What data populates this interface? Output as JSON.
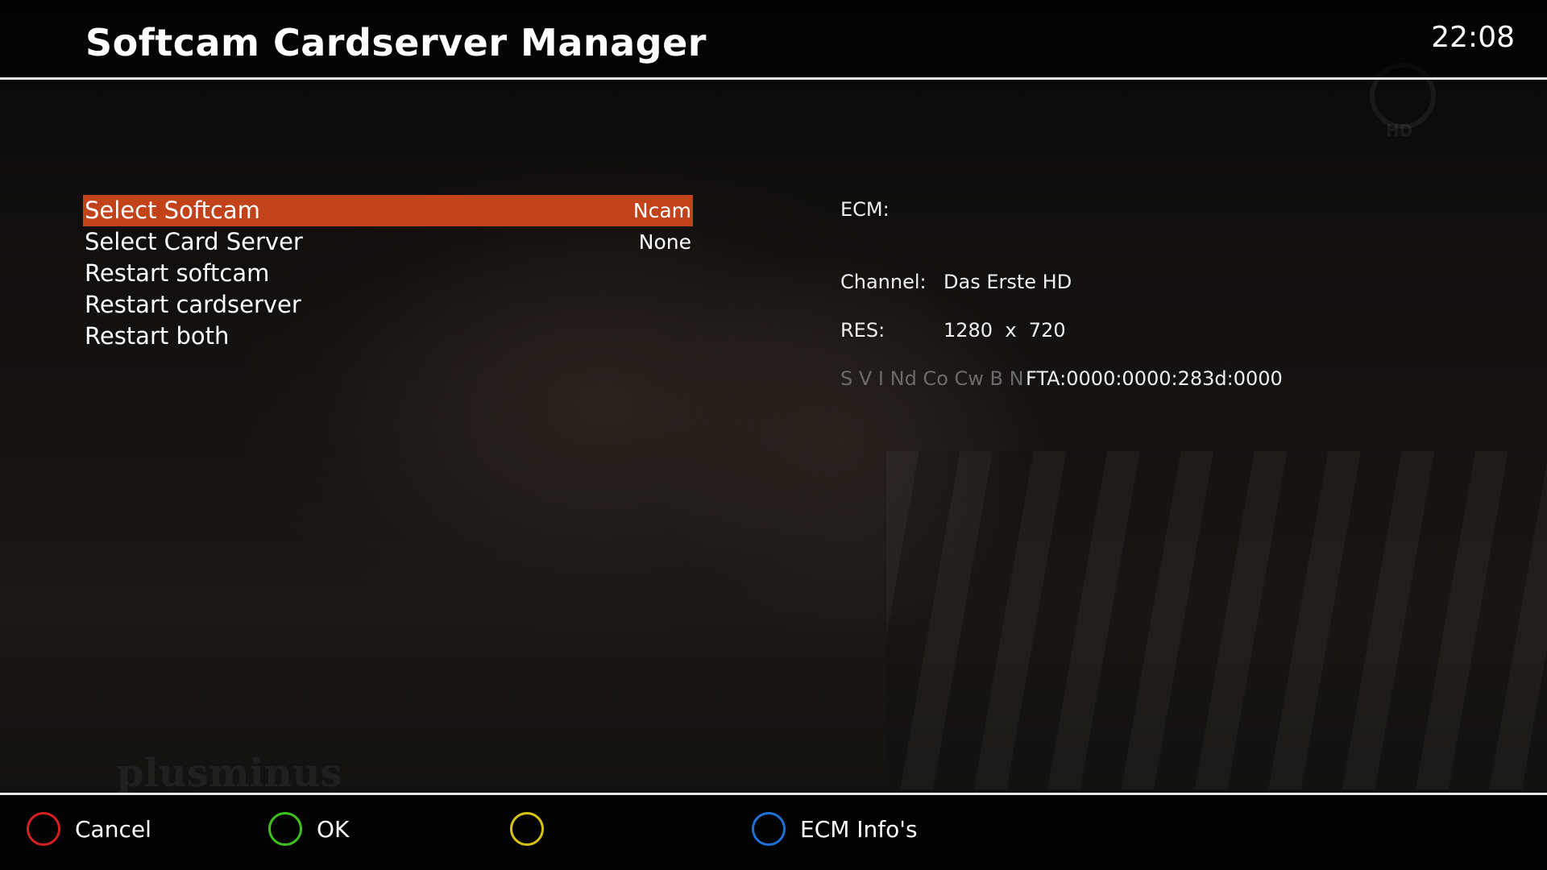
{
  "header": {
    "title": "Softcam Cardserver Manager",
    "clock": "22:08"
  },
  "menu": {
    "items": [
      {
        "label": "Select Softcam",
        "value": "Ncam",
        "selected": true
      },
      {
        "label": "Select Card Server",
        "value": "None",
        "selected": false
      },
      {
        "label": "Restart softcam",
        "value": "",
        "selected": false
      },
      {
        "label": "Restart cardserver",
        "value": "",
        "selected": false
      },
      {
        "label": "Restart both",
        "value": "",
        "selected": false
      }
    ]
  },
  "info": {
    "ecm_label": "ECM:",
    "channel_label": "Channel:",
    "channel_value": "Das Erste HD",
    "res_label": "RES:",
    "res_value": "1280  x  720",
    "caids_label": "S V I Nd Co Cw B N",
    "caids_value": "FTA:0000:0000:283d:0000"
  },
  "background": {
    "watermark": "plusminus",
    "logo_text": "HD"
  },
  "footer": {
    "buttons": [
      {
        "label": "Cancel",
        "color": "#d42020"
      },
      {
        "label": "OK",
        "color": "#3cc21c"
      },
      {
        "label": "",
        "color": "#d6c410"
      },
      {
        "label": "ECM Info's",
        "color": "#1e6fd6"
      }
    ]
  },
  "colors": {
    "accent": "#c2431a",
    "divider": "#e8e8e8"
  }
}
